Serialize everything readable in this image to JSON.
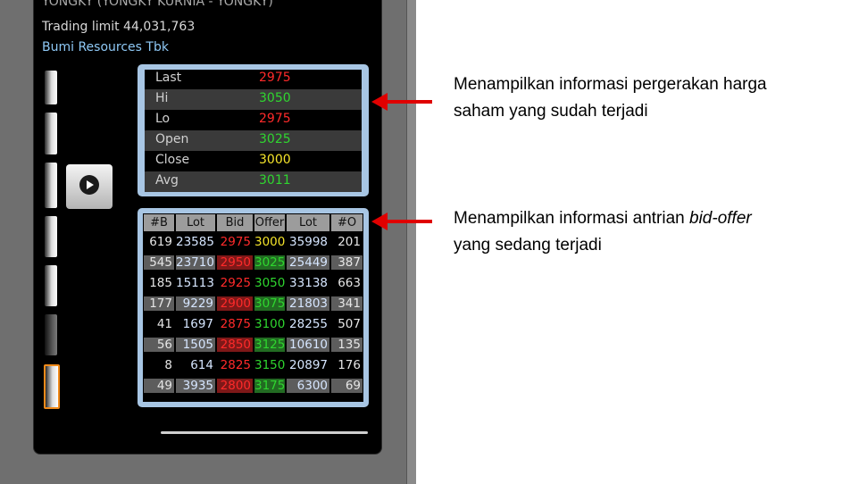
{
  "header": {
    "user": "YONGKY (YONGKY KURNIA - YONGKY)",
    "trading_limit": "Trading limit 44,031,763",
    "company": "Bumi Resources Tbk"
  },
  "price_table": [
    {
      "label": "Last",
      "value": "2975",
      "color": "#ff2a2a"
    },
    {
      "label": "Hi",
      "value": "3050",
      "color": "#2fd62f"
    },
    {
      "label": "Lo",
      "value": "2975",
      "color": "#ff2a2a"
    },
    {
      "label": "Open",
      "value": "3025",
      "color": "#2fd62f"
    },
    {
      "label": "Close",
      "value": "3000",
      "color": "#f5e42a"
    },
    {
      "label": "Avg",
      "value": "3011",
      "color": "#2fd62f"
    }
  ],
  "orderbook": {
    "headers": [
      "#B",
      "Lot",
      "Bid",
      "Offer",
      "Lot",
      "#O"
    ],
    "rows": [
      [
        "619",
        "23585",
        "2975",
        "3000",
        "35998",
        "201"
      ],
      [
        "545",
        "23710",
        "2950",
        "3025",
        "25449",
        "387"
      ],
      [
        "185",
        "15113",
        "2925",
        "3050",
        "33138",
        "663"
      ],
      [
        "177",
        "9229",
        "2900",
        "3075",
        "21803",
        "341"
      ],
      [
        "41",
        "1697",
        "2875",
        "3100",
        "28255",
        "507"
      ],
      [
        "56",
        "1505",
        "2850",
        "3125",
        "10610",
        "135"
      ],
      [
        "8",
        "614",
        "2825",
        "3150",
        "20897",
        "176"
      ],
      [
        "49",
        "3935",
        "2800",
        "3175",
        "6300",
        "69"
      ]
    ]
  },
  "annotations": {
    "price_text_1": "Menampilkan informasi pergerakan harga",
    "price_text_2": "saham yang sudah terjadi",
    "queue_text_1a": "Menampilkan informasi antrian ",
    "queue_text_1b": "bid-offer",
    "queue_text_2": "yang sedang terjadi"
  },
  "colors": {
    "red": "#ff2a2a",
    "green": "#2fd62f",
    "yellow": "#f5e42a",
    "panel_border": "#a8c6e4",
    "arrow": "#e00000"
  }
}
